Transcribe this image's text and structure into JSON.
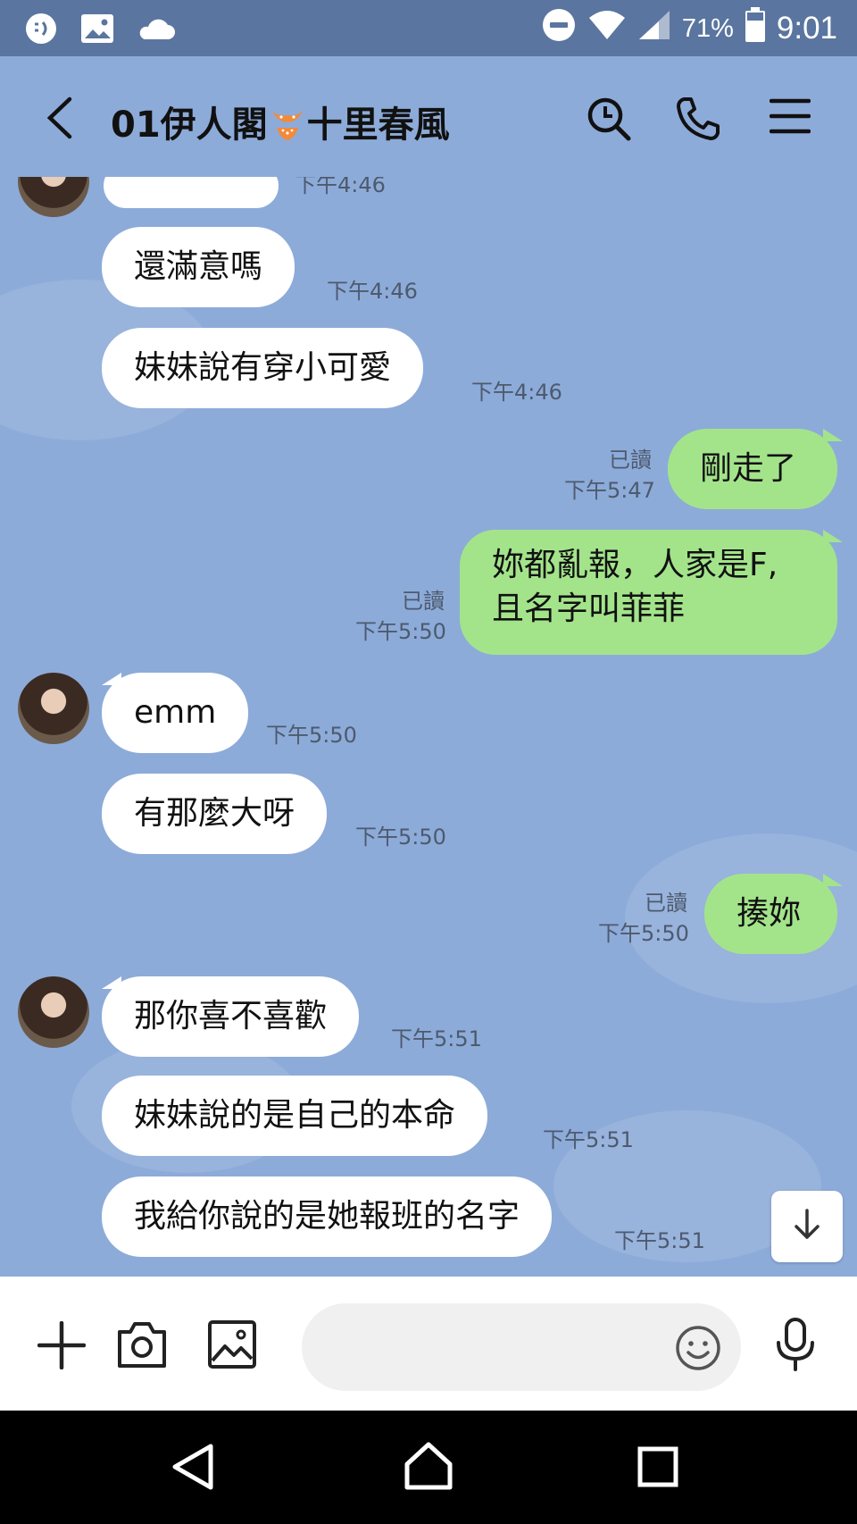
{
  "status_bar": {
    "battery": "71%",
    "time": "9:01"
  },
  "header": {
    "title_prefix": "01伊人閣",
    "title_suffix": "十里春風"
  },
  "messages": [
    {
      "dir": "in",
      "text": "",
      "time": "下午4:46"
    },
    {
      "dir": "in",
      "text": "還滿意嗎",
      "time": "下午4:46"
    },
    {
      "dir": "in",
      "text": "妹妹說有穿小可愛",
      "time": "下午4:46"
    },
    {
      "dir": "out",
      "text": "剛走了",
      "read": "已讀",
      "time": "下午5:47"
    },
    {
      "dir": "out",
      "line1": "妳都亂報，人家是F,",
      "line2": "且名字叫菲菲",
      "read": "已讀",
      "time": "下午5:50"
    },
    {
      "dir": "in",
      "text": "emm",
      "time": "下午5:50"
    },
    {
      "dir": "in",
      "text": "有那麼大呀",
      "time": "下午5:50"
    },
    {
      "dir": "out",
      "text": "揍妳",
      "read": "已讀",
      "time": "下午5:50"
    },
    {
      "dir": "in",
      "text": "那你喜不喜歡",
      "time": "下午5:51"
    },
    {
      "dir": "in",
      "text": "妹妹說的是自己的本命",
      "time": "下午5:51"
    },
    {
      "dir": "in",
      "text": "我給你說的是她報班的名字",
      "time": "下午5:51"
    }
  ],
  "input": {
    "placeholder": ""
  },
  "colors": {
    "chat_bg": "#8dabd9",
    "outgoing_bubble": "#a3e48b",
    "incoming_bubble": "#ffffff",
    "status_bar": "#5a759f"
  }
}
